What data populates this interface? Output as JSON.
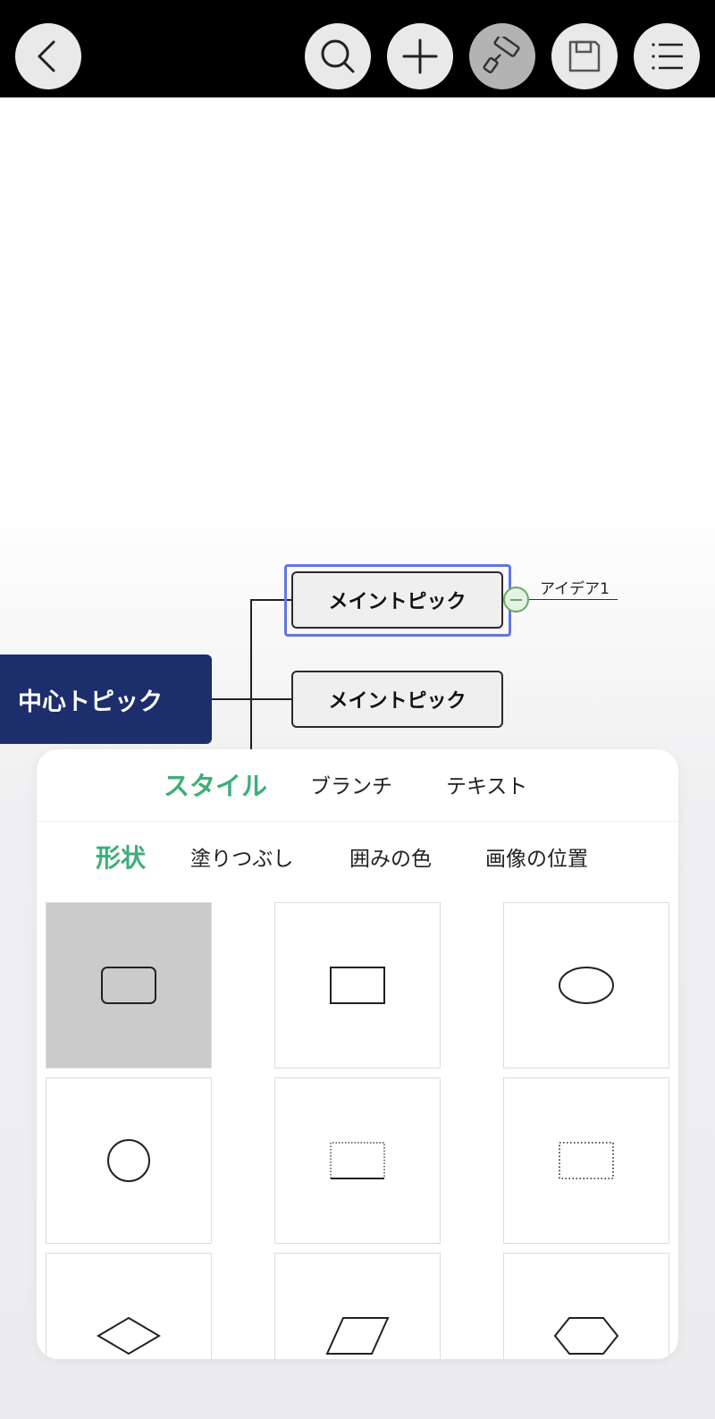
{
  "toolbar": {
    "buttons": [
      {
        "name": "back",
        "icon": "chevron-left-icon"
      },
      {
        "name": "search",
        "icon": "search-icon"
      },
      {
        "name": "add",
        "icon": "plus-icon"
      },
      {
        "name": "style",
        "icon": "paint-roller-icon",
        "active": true
      },
      {
        "name": "save",
        "icon": "save-icon"
      },
      {
        "name": "menu",
        "icon": "list-icon"
      }
    ]
  },
  "mindmap": {
    "central_topic": "中心トピック",
    "main_topics": [
      "メイントピック",
      "メイントピック"
    ],
    "sub_topic": "アイデア1",
    "colors": {
      "central": "#1c2e6b",
      "selection": "#6276e0",
      "collapse": "#6aa86a"
    }
  },
  "panel": {
    "tabs": [
      {
        "label": "スタイル",
        "active": true
      },
      {
        "label": "ブランチ",
        "active": false
      },
      {
        "label": "テキスト",
        "active": false
      }
    ],
    "subtabs": [
      {
        "label": "形状",
        "active": true
      },
      {
        "label": "塗りつぶし",
        "active": false
      },
      {
        "label": "囲みの色",
        "active": false
      },
      {
        "label": "画像の位置",
        "active": false
      }
    ],
    "accent_color": "#3fae78",
    "shapes": [
      {
        "name": "rounded-rectangle",
        "selected": true
      },
      {
        "name": "rectangle",
        "selected": false
      },
      {
        "name": "ellipse",
        "selected": false
      },
      {
        "name": "circle",
        "selected": false
      },
      {
        "name": "underline-dotted-rectangle",
        "selected": false
      },
      {
        "name": "dotted-rectangle",
        "selected": false
      },
      {
        "name": "diamond",
        "selected": false
      },
      {
        "name": "parallelogram",
        "selected": false
      },
      {
        "name": "hexagon",
        "selected": false
      }
    ]
  }
}
